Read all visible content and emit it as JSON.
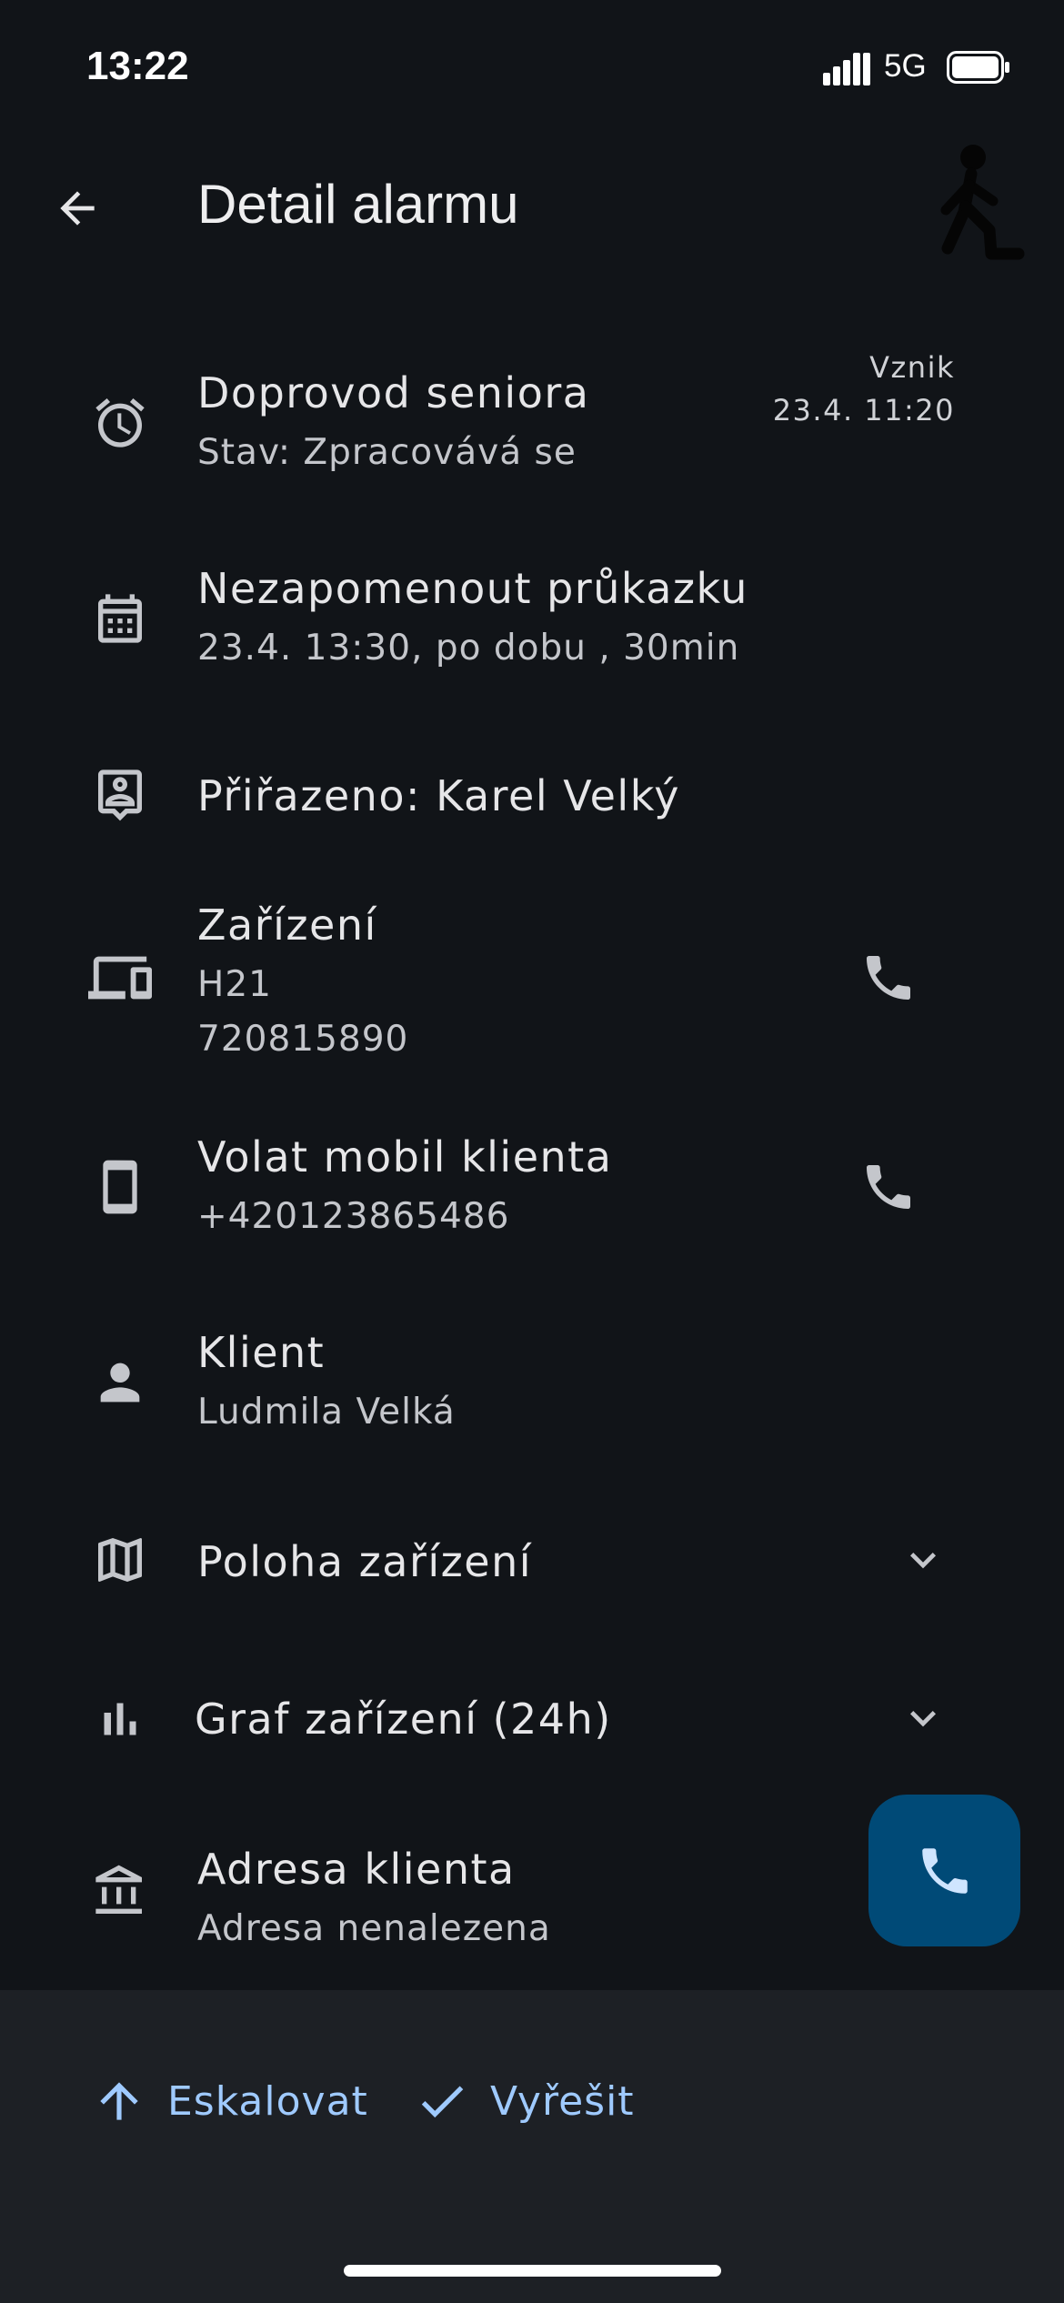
{
  "status_bar": {
    "time": "13:22",
    "network": "5G"
  },
  "header": {
    "title": "Detail alarmu",
    "back_icon": "arrow-back-icon",
    "avatar_icon": "walking-person-icon"
  },
  "alarm": {
    "title": "Doprovod seniora",
    "state": "Stav: Zpracovává se",
    "created_label": "Vznik",
    "created_value": "23.4. 11:20"
  },
  "reminder": {
    "title": "Nezapomenout průkazku",
    "detail": "23.4. 13:30, po dobu , 30min"
  },
  "assigned": {
    "title": "Přiřazeno: Karel Velký"
  },
  "device": {
    "title": "Zařízení",
    "name": "H21",
    "number": "720815890"
  },
  "client_phone": {
    "title": "Volat mobil klienta",
    "number": "+420123865486"
  },
  "client": {
    "title": "Klient",
    "name": "Ludmila Velká"
  },
  "device_location": {
    "title": "Poloha zařízení"
  },
  "device_chart": {
    "title": "Graf zařízení (24h)"
  },
  "client_address": {
    "title": "Adresa klienta",
    "value": "Adresa nenalezena"
  },
  "actions": {
    "escalate": "Eskalovat",
    "resolve": "Vyřešit"
  },
  "colors": {
    "background": "#111418",
    "bottom_bar": "#1d2025",
    "accent": "#9fcaff",
    "fab": "#004a77"
  }
}
